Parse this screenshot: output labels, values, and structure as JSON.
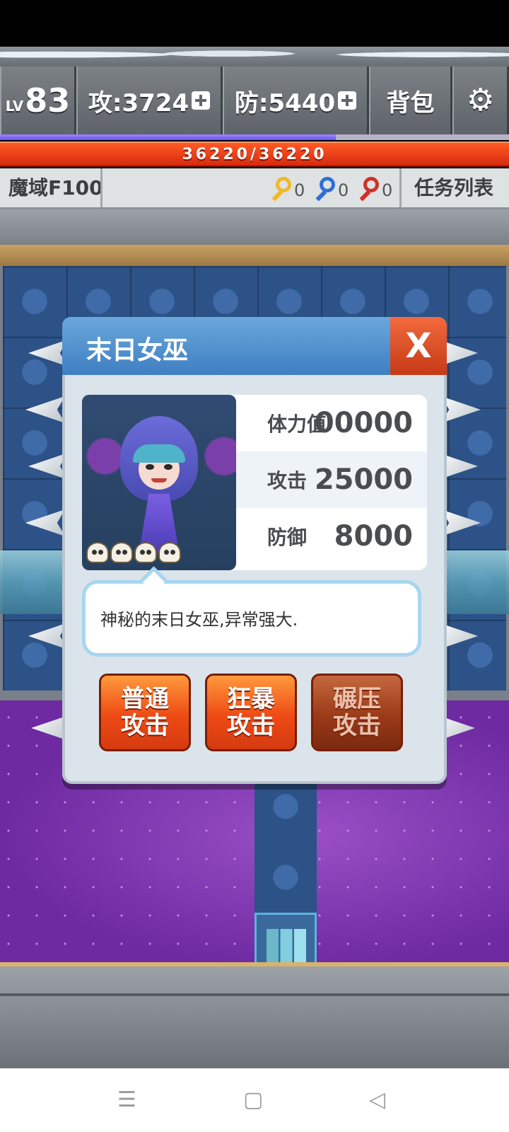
{
  "hud": {
    "level_prefix": "LV",
    "level": "83",
    "attack": "攻:3724",
    "defense": "防:5440",
    "bag": "背包",
    "hp": "36220/36220",
    "xp_fraction": 0.66,
    "floor": "魔域F100",
    "keys": {
      "yellow": "0",
      "blue": "0",
      "red": "0"
    },
    "task_list": "任务列表"
  },
  "dialog": {
    "title": "末日女巫",
    "close": "X",
    "stats": [
      {
        "label": "体力值",
        "value": "00000"
      },
      {
        "label": "攻击",
        "value": "25000"
      },
      {
        "label": "防御",
        "value": "8000"
      }
    ],
    "skull_count": 4,
    "description": "神秘的末日女巫,异常强大.",
    "buttons": [
      {
        "line1": "普通",
        "line2": "攻击"
      },
      {
        "line1": "狂暴",
        "line2": "攻击"
      },
      {
        "line1": "碾压",
        "line2": "攻击"
      }
    ]
  },
  "nav": {
    "menu": "☰",
    "home": "▢",
    "back": "◁"
  }
}
